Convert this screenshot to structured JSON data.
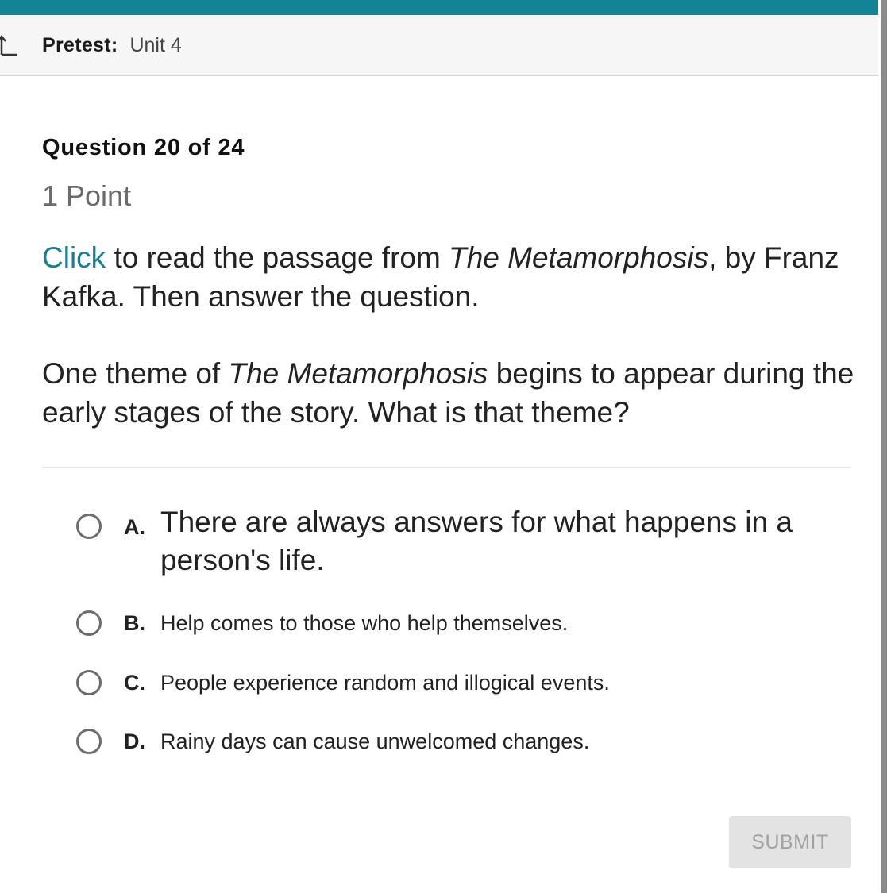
{
  "header": {
    "title_label": "Pretest:",
    "title_unit": "Unit 4",
    "back_icon": "back-arrow-icon",
    "accent_color": "#138496"
  },
  "question": {
    "number_text": "Question 20 of 24",
    "points_text": "1 Point",
    "prompt_link": "Click",
    "prompt_part1": " to read the passage from ",
    "prompt_title": "The Metamorphosis",
    "prompt_part2": ", by Franz Kafka. Then answer the question.",
    "stem_part1": "One theme of ",
    "stem_title": "The Metamorphosis",
    "stem_part2": " begins to appear during the early stages of the story. What is that theme?"
  },
  "options": [
    {
      "letter": "A.",
      "text": "There are always answers for what happens in a person's life.",
      "selected": false
    },
    {
      "letter": "B.",
      "text": "Help comes to those who help themselves.",
      "selected": false
    },
    {
      "letter": "C.",
      "text": "People experience random and illogical events.",
      "selected": false
    },
    {
      "letter": "D.",
      "text": "Rainy days can cause unwelcomed changes.",
      "selected": false
    }
  ],
  "submit": {
    "label": "SUBMIT",
    "enabled": false
  }
}
